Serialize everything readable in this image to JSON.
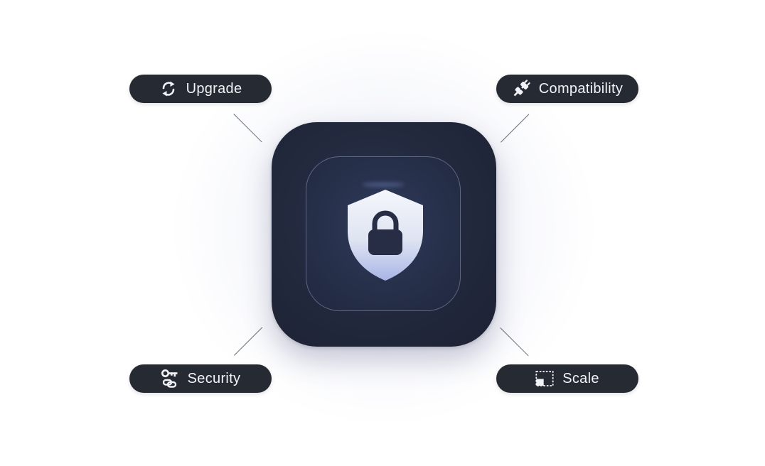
{
  "features": {
    "upgrade": {
      "label": "Upgrade",
      "icon": "refresh-icon"
    },
    "compatibility": {
      "label": "Compatibility",
      "icon": "plug-icon"
    },
    "security": {
      "label": "Security",
      "icon": "key-link-icon"
    },
    "scale": {
      "label": "Scale",
      "icon": "resize-icon"
    }
  },
  "center": {
    "icon": "shield-lock-icon"
  },
  "colors": {
    "pill_background": "#262a33",
    "pill_text": "#f2f3f7",
    "tile_dark": "#1d2233",
    "shield_light": "#e8ebf5",
    "shield_accent": "#a9b6e6"
  }
}
